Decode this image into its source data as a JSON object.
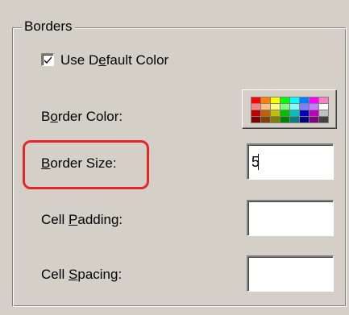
{
  "group": {
    "title": "Borders"
  },
  "default_color": {
    "label_pre": "Use D",
    "label_key": "e",
    "label_post": "fault Color",
    "checked": true
  },
  "border_color": {
    "label_pre": "B",
    "label_key": "o",
    "label_post": "rder Color:"
  },
  "border_size": {
    "label_pre": "",
    "label_key": "B",
    "label_post": "order Size:",
    "value": "5"
  },
  "cell_padding": {
    "label_pre": "Cell ",
    "label_key": "P",
    "label_post": "adding:",
    "value": ""
  },
  "cell_spacing": {
    "label_pre": "Cell ",
    "label_key": "S",
    "label_post": "pacing:",
    "value": ""
  },
  "palette": [
    "#ff0000",
    "#ff8000",
    "#ffff00",
    "#00ff00",
    "#00ffff",
    "#0080ff",
    "#ff00ff",
    "#ff80c0",
    "#ff8080",
    "#ffc080",
    "#ffff80",
    "#80ff80",
    "#80ffff",
    "#8080ff",
    "#c080ff",
    "#ffffff",
    "#c00000",
    "#c06000",
    "#c0c000",
    "#00c000",
    "#00c0c0",
    "#0000c0",
    "#c000c0",
    "#c0c0c0",
    "#800000",
    "#804000",
    "#808000",
    "#008000",
    "#008080",
    "#000080",
    "#800080",
    "#404040"
  ],
  "colors": {
    "highlight": "#e4252a",
    "background": "#d4d0c8"
  }
}
